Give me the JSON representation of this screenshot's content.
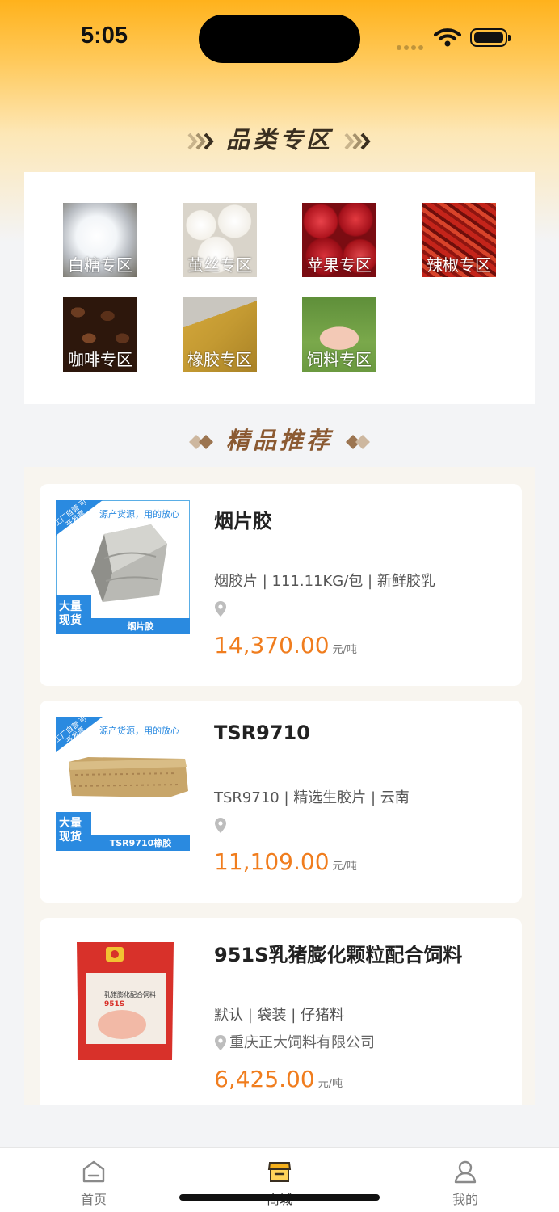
{
  "status_bar": {
    "time": "5:05"
  },
  "category_section": {
    "title": "品类专区",
    "items": [
      {
        "label": "白糖专区",
        "icon": "sugar-image"
      },
      {
        "label": "茧丝专区",
        "icon": "silk-cocoon-image"
      },
      {
        "label": "苹果专区",
        "icon": "apple-image"
      },
      {
        "label": "辣椒专区",
        "icon": "chili-image"
      },
      {
        "label": "咖啡专区",
        "icon": "coffee-bean-image"
      },
      {
        "label": "橡胶专区",
        "icon": "rubber-image"
      },
      {
        "label": "饲料专区",
        "icon": "feed-pig-image"
      }
    ]
  },
  "recommend_section": {
    "title": "精品推荐",
    "products": [
      {
        "name": "烟片胶",
        "spec": "烟胶片 | 111.11KG/包 | 新鲜胶乳",
        "location": "",
        "price": "14,370.00",
        "unit": "元/吨",
        "thumb": {
          "corner": "工厂自营 可开发票",
          "slogan": "源产货源，用的放心",
          "badge": "大量 现货",
          "caption": "烟片胶"
        }
      },
      {
        "name": "TSR9710",
        "spec": "TSR9710 | 精选生胶片 | 云南",
        "location": "",
        "price": "11,109.00",
        "unit": "元/吨",
        "thumb": {
          "corner": "工厂自营 可开发票",
          "slogan": "源产货源，用的放心",
          "badge": "大量 现货",
          "caption": "TSR9710橡胶"
        }
      },
      {
        "name": "951S乳猪膨化颗粒配合饲料",
        "spec": "默认 | 袋装 | 仔猪料",
        "location": "重庆正大饲料有限公司",
        "price": "6,425.00",
        "unit": "元/吨",
        "thumb": {
          "bag_title": "乳猪膨化配合饲料",
          "bag_code": "951S"
        }
      }
    ]
  },
  "tab_bar": {
    "tabs": [
      {
        "label": "首页",
        "icon": "home-icon"
      },
      {
        "label": "商城",
        "icon": "shop-icon",
        "active": true
      },
      {
        "label": "我的",
        "icon": "user-icon"
      }
    ]
  },
  "colors": {
    "accent": "#f07d1e",
    "header": "#ffb21c",
    "section_title": "#8b5a32"
  }
}
